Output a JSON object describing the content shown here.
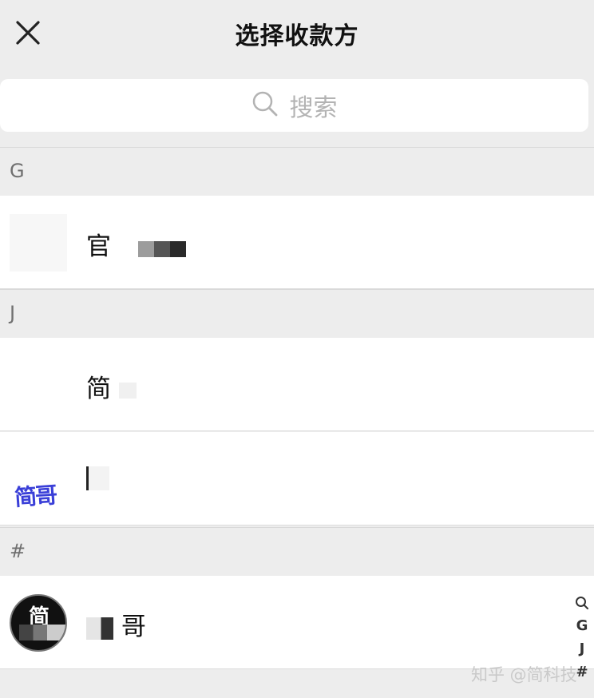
{
  "header": {
    "title": "选择收款方"
  },
  "search": {
    "placeholder": "搜索"
  },
  "sections": [
    {
      "letter": "G",
      "contacts": [
        {
          "name_visible": "官"
        }
      ]
    },
    {
      "letter": "J",
      "contacts": [
        {
          "name_visible": "简"
        },
        {
          "name_visible": "",
          "avatar_text": "简哥"
        }
      ]
    },
    {
      "letter": "#",
      "contacts": [
        {
          "name_visible": "哥",
          "avatar_text": "简"
        }
      ]
    }
  ],
  "index_bar": [
    "G",
    "J",
    "#"
  ],
  "watermark": "知乎 @简科技",
  "colors": {
    "background": "#ededed",
    "row": "#ffffff",
    "section_text": "#707070",
    "avatar_stamp": "#3a3fd8"
  }
}
